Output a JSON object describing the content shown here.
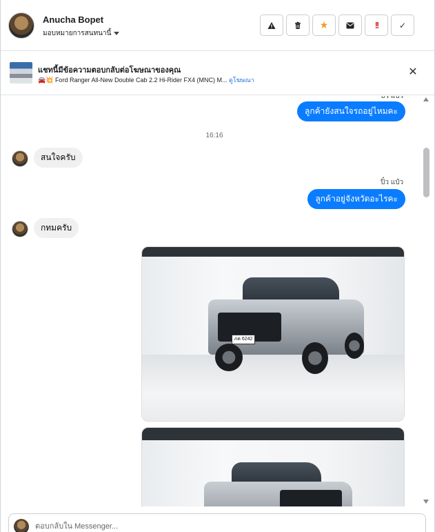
{
  "header": {
    "name": "Anucha Bopet",
    "subtitle": "มอบหมายการสนทนานี้",
    "actions": [
      {
        "icon": "warning-icon",
        "glyph": "▲"
      },
      {
        "icon": "trash-icon",
        "glyph": "🗑"
      },
      {
        "icon": "star-icon",
        "glyph": "★"
      },
      {
        "icon": "envelope-icon",
        "glyph": "✉"
      },
      {
        "icon": "exclamation-icon",
        "glyph": "!!"
      },
      {
        "icon": "check-icon",
        "glyph": "✓"
      }
    ]
  },
  "banner": {
    "title": "แชทนี้มีข้อความตอบกลับต่อโฆษณาของคุณ",
    "emoji": "🚘💥",
    "subtitle": "Ford Ranger All-New Double Cab 2.2 Hi-Rider FX4 (MNC) M...",
    "link": "ดูโฆษณา"
  },
  "messages": {
    "cut_sender": "ปิว แป๋ว",
    "out1": "ลูกค้ายังสนใจรถอยู่ไหมคะ",
    "time": "16:16",
    "in1": "สนใจครับ",
    "sender2": "ปิ๋ว แป๋ว",
    "out2": "ลูกค้าอยู่จังหวัดอะไรคะ",
    "in2": "กทมครับ",
    "plate": "ภค 6242"
  },
  "reply": {
    "placeholder": "ตอบกลับใน Messenger..."
  },
  "colors": {
    "outgoing_bubble": "#0a7cff",
    "incoming_bubble": "#f0f0f0",
    "link": "#216fdb",
    "star": "#f29b1f",
    "exclamation": "#d22d2d"
  }
}
